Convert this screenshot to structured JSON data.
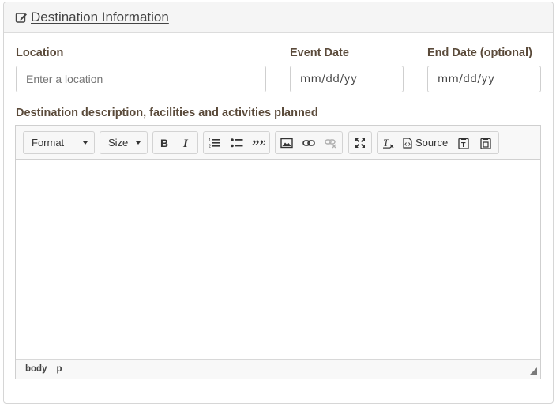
{
  "panel": {
    "title": "Destination Information"
  },
  "form": {
    "location": {
      "label": "Location",
      "placeholder": "Enter a location",
      "value": ""
    },
    "event_date": {
      "label": "Event Date",
      "display": "mm/dd/yy"
    },
    "end_date": {
      "label": "End Date (optional)",
      "display": "mm/dd/yy"
    },
    "description": {
      "label": "Destination description, facilities and activities planned"
    }
  },
  "editor": {
    "toolbar": {
      "format_label": "Format",
      "size_label": "Size",
      "source_label": "Source"
    },
    "statusbar": {
      "path": [
        "body",
        "p"
      ]
    }
  }
}
